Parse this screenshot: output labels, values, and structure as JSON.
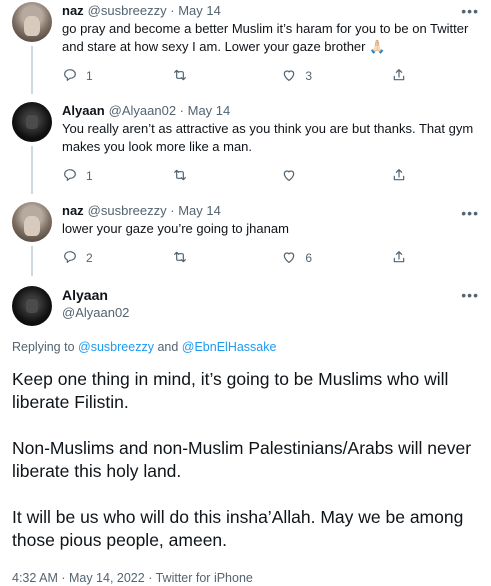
{
  "tweets": [
    {
      "avatar": "naz-avatar",
      "name": "naz",
      "handle": "@susbreezzy",
      "date": "May 14",
      "text": "go pray and become a better Muslim it’s haram for you to be on Twitter and stare at how sexy I am. Lower your gaze brother 🙏🏻",
      "replies": "1",
      "retweets": "",
      "likes": "3"
    },
    {
      "avatar": "alyaan-avatar",
      "name": "Alyaan",
      "handle": "@Alyaan02",
      "date": "May 14",
      "text": "You really aren’t as attractive as you think you are but thanks. That gym makes you look more like a man.",
      "replies": "1",
      "retweets": "",
      "likes": ""
    },
    {
      "avatar": "naz-avatar",
      "name": "naz",
      "handle": "@susbreezzy",
      "date": "May 14",
      "text": "lower your gaze you’re going to jhanam",
      "replies": "2",
      "retweets": "",
      "likes": "6"
    }
  ],
  "main_tweet": {
    "name": "Alyaan",
    "handle": "@Alyaan02",
    "replying_prefix": "Replying to",
    "replying_user1": "@susbreezzy",
    "replying_and": "and",
    "replying_user2": "@EbnElHassake",
    "paragraphs": [
      "Keep one thing in mind, it’s going to be Muslims who will liberate Filistin.",
      "Non-Muslims and non-Muslim Palestinians/Arabs will never liberate this holy land.",
      "It will be us who will do this insha’Allah. May we be among those pious people, ameen."
    ],
    "meta": "4:32 AM · May 14, 2022 · Twitter for iPhone"
  },
  "more_glyph": "•••",
  "separator": " · ",
  "icons": {
    "reply": "reply-icon",
    "retweet": "retweet-icon",
    "like": "heart-icon",
    "share": "share-icon",
    "more": "more-icon"
  },
  "colors": {
    "link": "#1d9bf0",
    "secondary_text": "#536471",
    "primary_text": "#0f1419",
    "thread_line": "#cfd9de"
  }
}
